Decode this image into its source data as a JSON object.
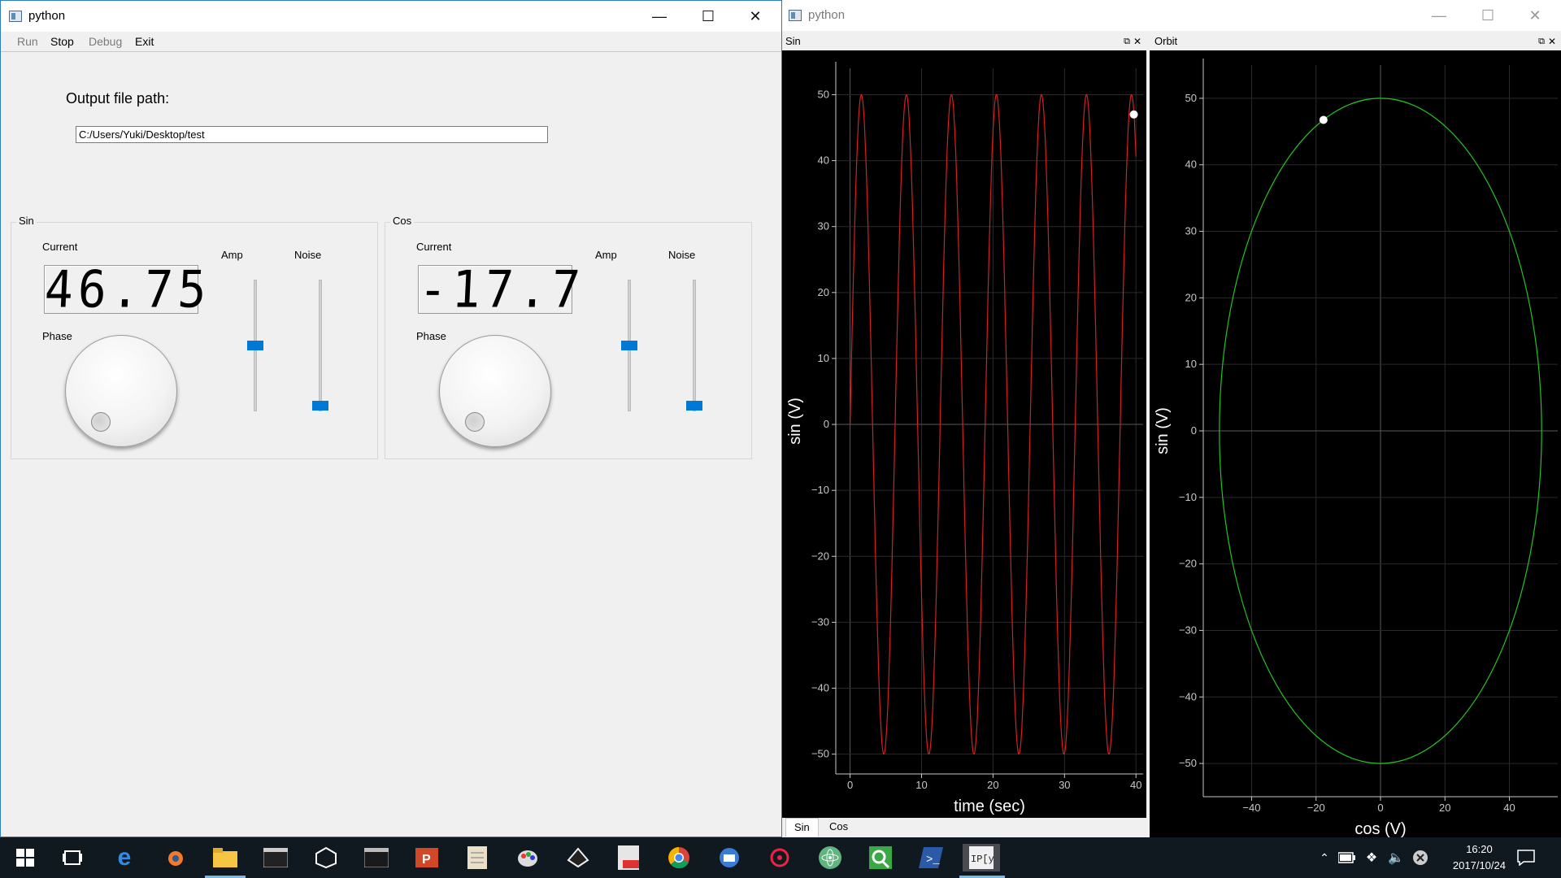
{
  "left_window": {
    "title": "python",
    "menu": [
      {
        "label": "Run",
        "enabled": false
      },
      {
        "label": "Stop",
        "enabled": true
      },
      {
        "label": "Debug",
        "enabled": false
      },
      {
        "label": "Exit",
        "enabled": true
      }
    ],
    "output_label": "Output file path:",
    "output_path": "C:/Users/Yuki/Desktop/test",
    "sin_group": {
      "title": "Sin",
      "current_label": "Current",
      "current_value": "46.75",
      "phase_label": "Phase",
      "amp_label": "Amp",
      "noise_label": "Noise",
      "amp_level": 0.5,
      "noise_level": 0.04
    },
    "cos_group": {
      "title": "Cos",
      "current_label": "Current",
      "current_value": "-17.7",
      "phase_label": "Phase",
      "amp_label": "Amp",
      "noise_label": "Noise",
      "amp_level": 0.5,
      "noise_level": 0.04
    }
  },
  "right_window": {
    "title": "python",
    "sin_panel_title": "Sin",
    "orbit_panel_title": "Orbit",
    "tabs": [
      "Sin",
      "Cos"
    ],
    "active_tab": "Sin"
  },
  "chart_data": [
    {
      "type": "line",
      "title": "",
      "xlabel": "time (sec)",
      "ylabel": "sin (V)",
      "xlim": [
        -2,
        41
      ],
      "ylim": [
        -53,
        54
      ],
      "xticks": [
        0,
        10,
        20,
        30,
        40
      ],
      "yticks": [
        50,
        40,
        30,
        20,
        10,
        0,
        -10,
        -20,
        -30,
        -40,
        -50
      ],
      "grid": true,
      "color": "#d42020",
      "series": [
        {
          "amplitude": 50,
          "period": 6.3,
          "x_range": [
            0,
            40
          ]
        }
      ],
      "current_point": {
        "x": 39.7,
        "y": 47
      }
    },
    {
      "type": "line",
      "title": "",
      "xlabel": "cos (V)",
      "ylabel": "sin (V)",
      "xlim": [
        -55,
        55
      ],
      "ylim": [
        -55,
        55
      ],
      "xticks": [
        -40,
        -20,
        0,
        20,
        40
      ],
      "yticks": [
        50,
        40,
        30,
        20,
        10,
        0,
        -10,
        -20,
        -30,
        -40,
        -50
      ],
      "grid": true,
      "color": "#22c322",
      "series": [
        {
          "shape": "ellipse",
          "center": [
            0,
            0
          ],
          "radius_x": 50,
          "radius_y": 50
        }
      ],
      "current_point": {
        "x": -17.7,
        "y": 46.75
      }
    }
  ],
  "taskbar": {
    "time": "16:20",
    "date": "2017/10/24",
    "icons": [
      "windows-start",
      "task-view",
      "edge",
      "blender",
      "file-explorer",
      "terminal",
      "unity",
      "console",
      "powerpoint",
      "notepad",
      "paint",
      "inkscape",
      "pdf",
      "chrome",
      "thunderbird",
      "settings",
      "atom",
      "qlik",
      "powershell",
      "ipython"
    ]
  }
}
